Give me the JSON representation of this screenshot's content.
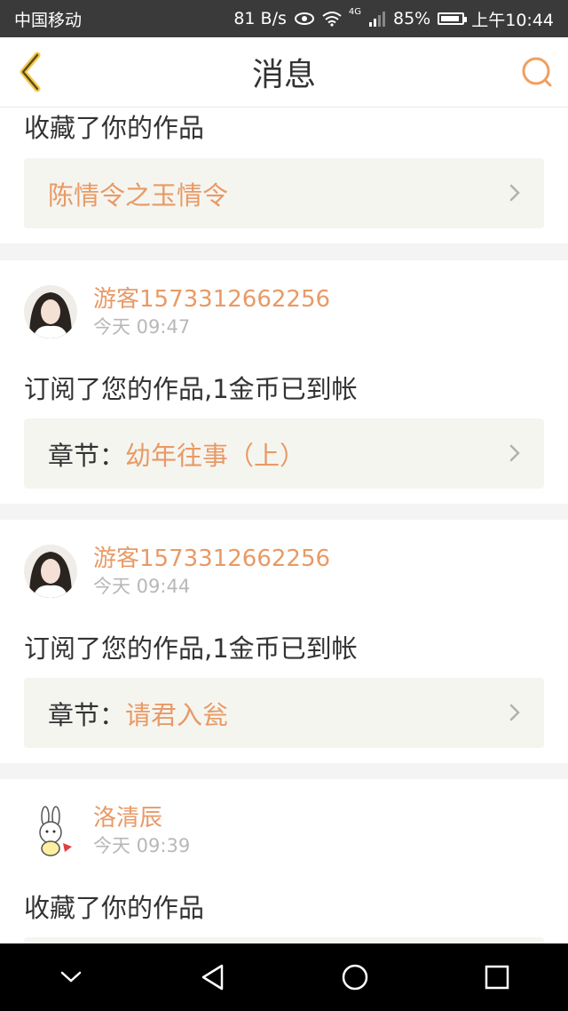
{
  "status_bar": {
    "carrier": "中国移动",
    "speed": "81 B/s",
    "network": "4G",
    "battery": "85%",
    "time": "上午10:44"
  },
  "nav": {
    "title": "消息",
    "accent_color": "#e89a66"
  },
  "messages": [
    {
      "action": "收藏了你的作品",
      "work_prefix": "",
      "work_title": "陈情令之玉情令"
    },
    {
      "username": "游客1573312662256",
      "time": "今天 09:47",
      "action": "订阅了您的作品,1金币已到帐",
      "work_prefix": "章节：",
      "work_title": "幼年往事（上）"
    },
    {
      "username": "游客1573312662256",
      "time": "今天 09:44",
      "action": "订阅了您的作品,1金币已到帐",
      "work_prefix": "章节：",
      "work_title": "请君入瓮"
    },
    {
      "username": "洛清辰",
      "time": "今天 09:39",
      "action": "收藏了你的作品"
    }
  ]
}
